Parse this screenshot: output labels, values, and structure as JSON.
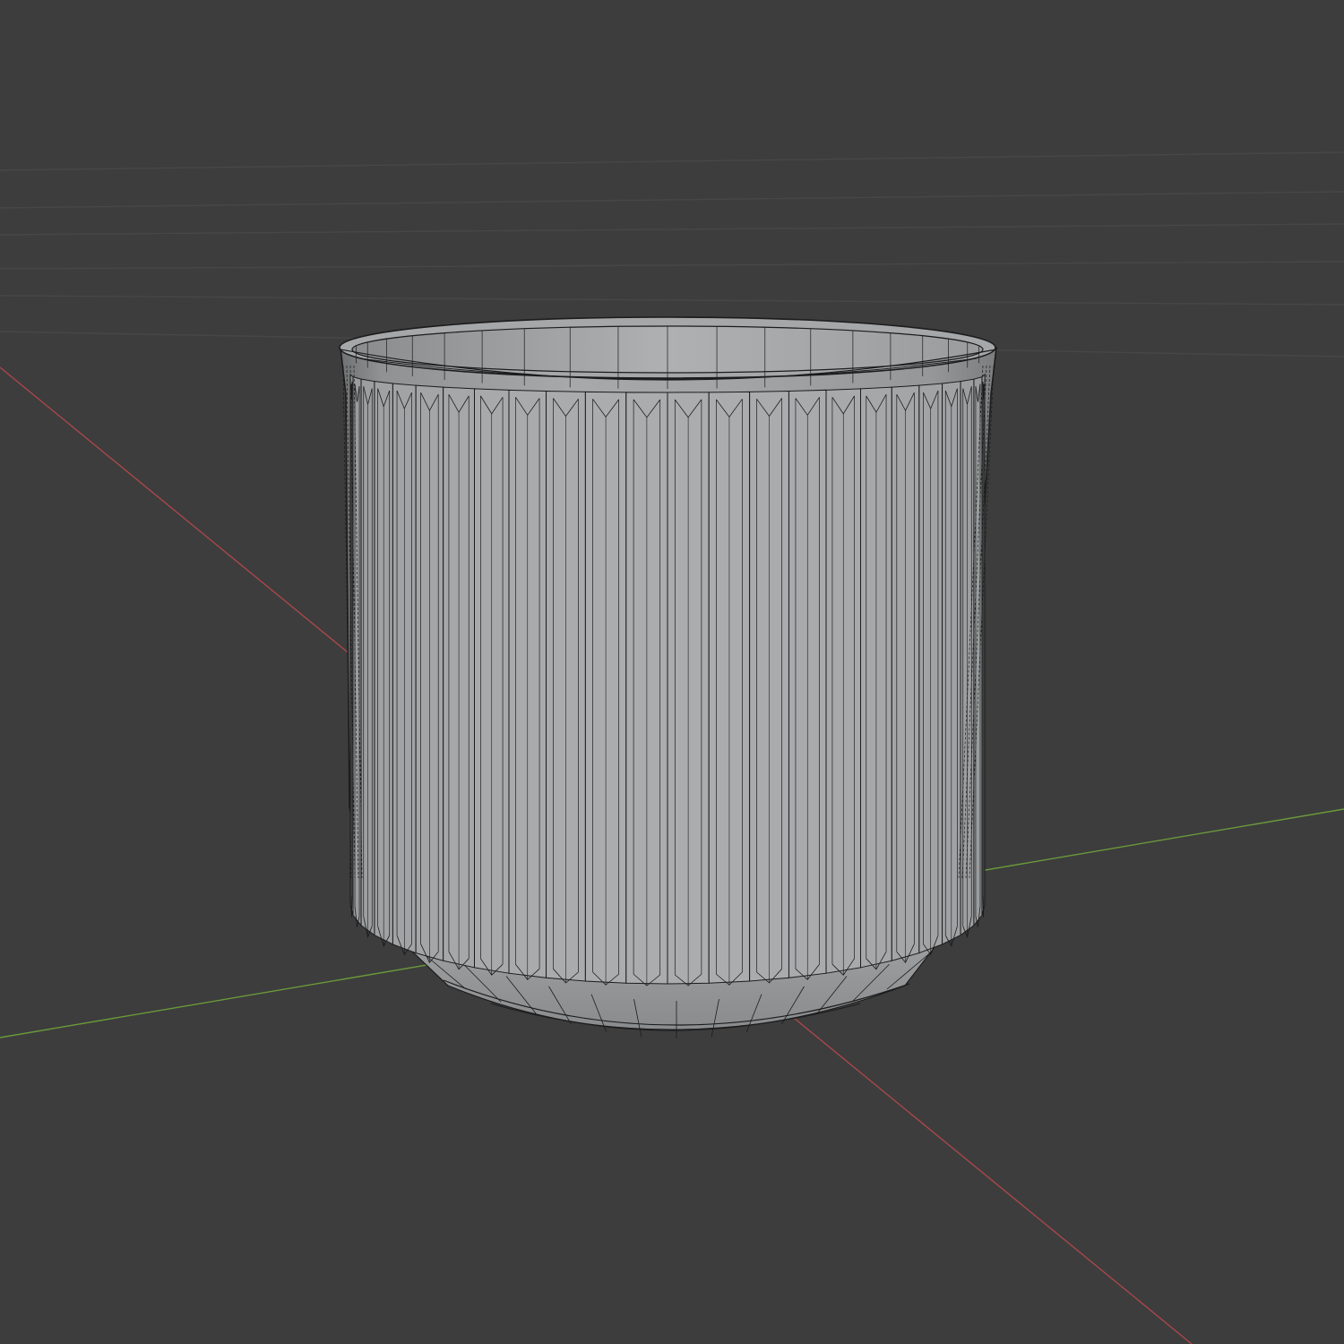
{
  "viewport": {
    "background_color": "#3d3d3d",
    "grid_line_color": "#474747",
    "x_axis_color": "#a8474a",
    "y_axis_color": "#6a9a3a",
    "show_grid_floor": true,
    "show_axes": [
      "X",
      "Y"
    ],
    "shading_mode": "solid",
    "wireframe_overlay": true
  },
  "object": {
    "name_icon": "planter-pot-mesh",
    "shape": "fluted-cylinder-pot",
    "surface_color": "#a3a6a8",
    "inner_wall_color": "#9a9c9e",
    "wire_color": "#1c1c1c",
    "flute_count_visible": 24,
    "has_beveled_base": true,
    "has_rim": true
  }
}
